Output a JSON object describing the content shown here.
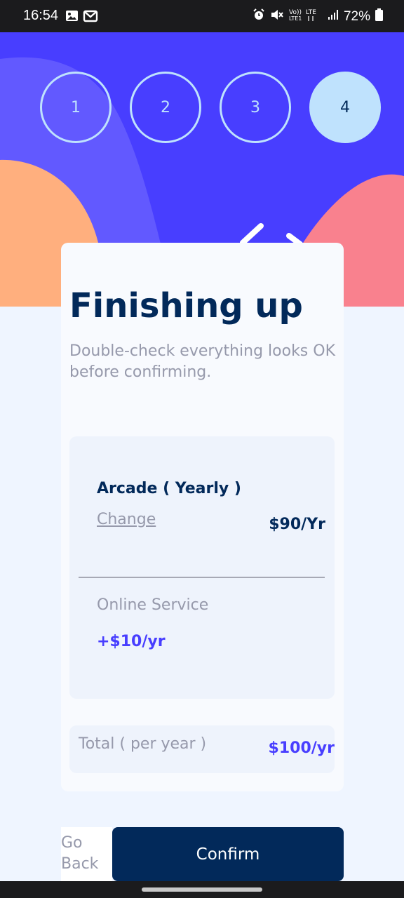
{
  "status_bar": {
    "time": "16:54",
    "battery": "72%",
    "left_icons": [
      "image-icon",
      "gmail-icon"
    ],
    "right_icons": [
      "alarm-icon",
      "mute-icon",
      "volte-lte-icon",
      "signal-icon",
      "battery-icon"
    ]
  },
  "steps": [
    {
      "label": "1",
      "active": false
    },
    {
      "label": "2",
      "active": false
    },
    {
      "label": "3",
      "active": false
    },
    {
      "label": "4",
      "active": true
    }
  ],
  "page": {
    "title": "Finishing up",
    "subtitle": "Double-check everything looks OK before confirming."
  },
  "summary": {
    "plan_name": "Arcade ( Yearly )",
    "change_label": "Change",
    "plan_price": "$90/Yr",
    "addon_name": "Online Service",
    "addon_price": "+$10/yr"
  },
  "total": {
    "label": "Total ( per year )",
    "value": "$100/yr"
  },
  "actions": {
    "back_label": "Go Back",
    "confirm_label": "Confirm"
  },
  "colors": {
    "hero_bg": "#483eff",
    "step_active": "#bfe2fd",
    "navy": "#02295a",
    "accent": "#483eff",
    "orange_shape": "#ffaf7e",
    "pink_shape": "#f9818e"
  }
}
